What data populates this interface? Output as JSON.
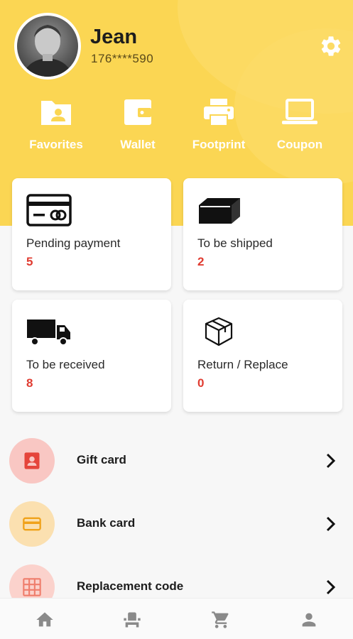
{
  "profile": {
    "name": "Jean",
    "phone": "176****590"
  },
  "quick_actions": [
    {
      "label": "Favorites",
      "icon": "folder-user-icon"
    },
    {
      "label": "Wallet",
      "icon": "wallet-icon"
    },
    {
      "label": "Footprint",
      "icon": "printer-icon"
    },
    {
      "label": "Coupon",
      "icon": "laptop-icon"
    }
  ],
  "orders": [
    {
      "label": "Pending payment",
      "count": "5",
      "icon": "credit-card-icon"
    },
    {
      "label": "To be shipped",
      "count": "2",
      "icon": "box-icon"
    },
    {
      "label": "To be received",
      "count": "8",
      "icon": "truck-icon"
    },
    {
      "label": "Return / Replace",
      "count": "0",
      "icon": "package-icon"
    }
  ],
  "menu": [
    {
      "label": "Gift card",
      "icon": "contact-card-icon"
    },
    {
      "label": "Bank card",
      "icon": "bank-card-icon"
    },
    {
      "label": "Replacement code",
      "icon": "grid-code-icon"
    }
  ],
  "colors": {
    "header": "#fbd653",
    "count_red": "#e03c31",
    "gift_bg": "#f9c7c3",
    "bank_bg": "#fbe0b0",
    "replace_bg": "#fbd2cc"
  },
  "bottom_nav": [
    "home-icon",
    "seat-icon",
    "cart-icon",
    "user-icon"
  ]
}
